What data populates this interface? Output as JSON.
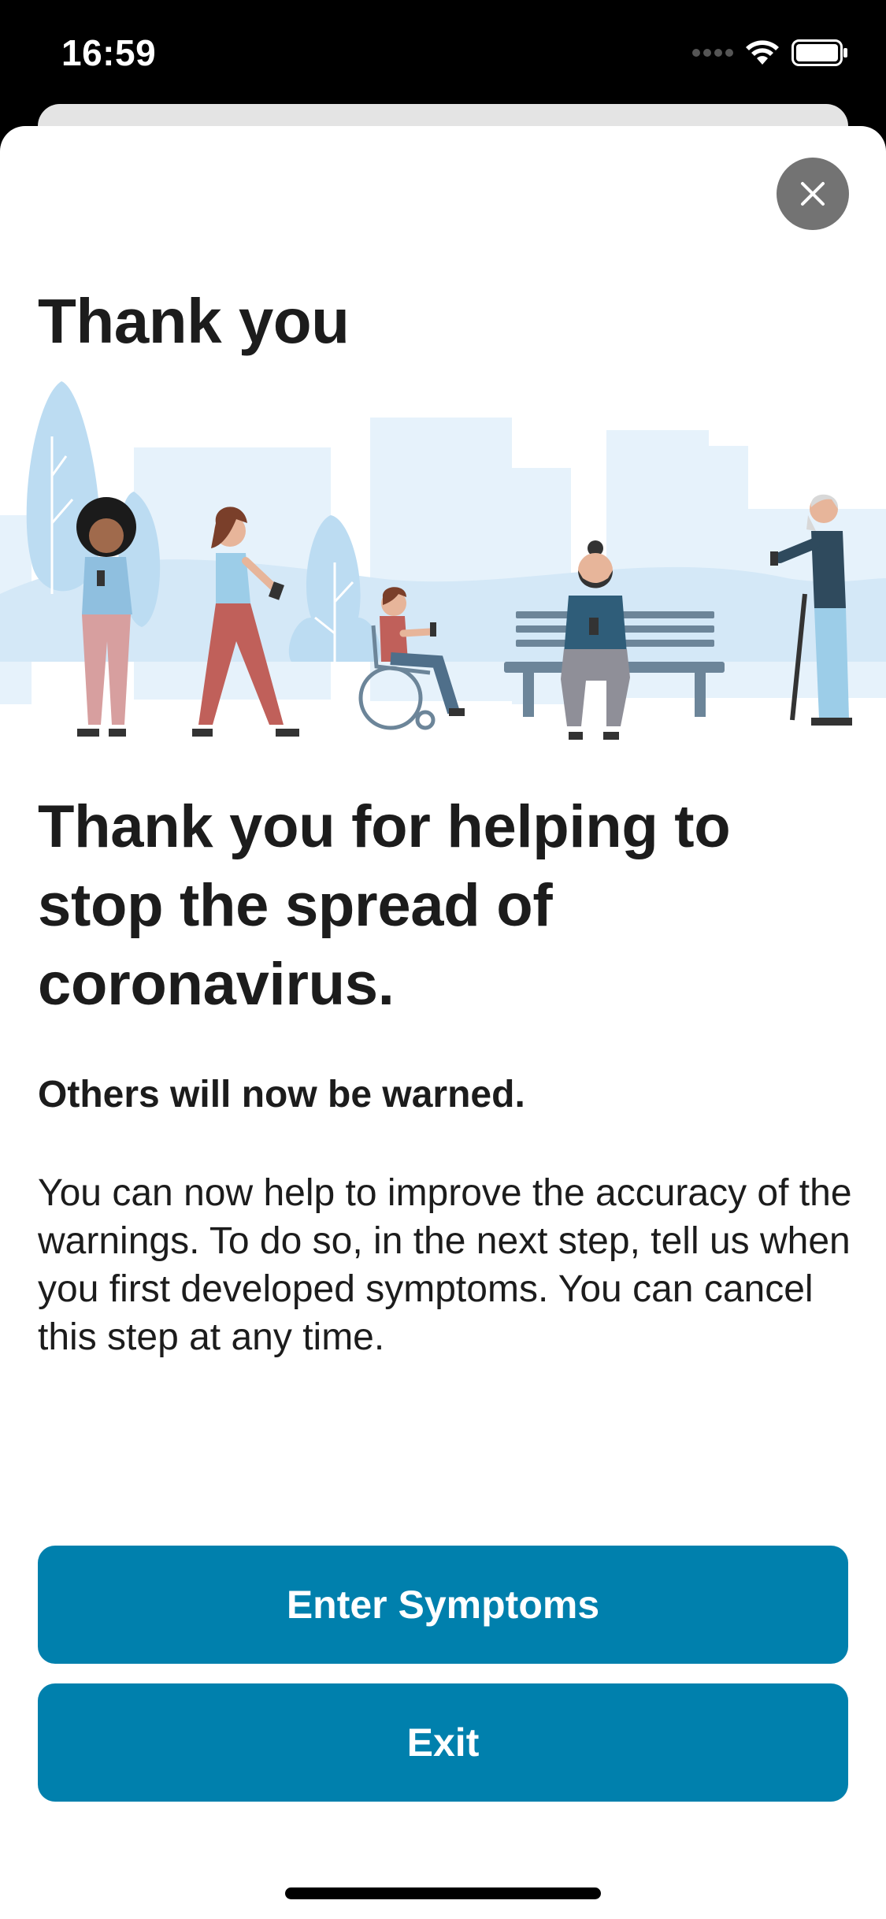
{
  "status_bar": {
    "time": "16:59"
  },
  "page": {
    "title": "Thank you",
    "headline": "Thank you for helping to stop the spread of coronavirus.",
    "subheadline": "Others will now be warned.",
    "body": "You can now help to improve the accuracy of the warnings. To do so, in the next step, tell us when you first developed symptoms. You can cancel this step at any time."
  },
  "buttons": {
    "enter_symptoms": "Enter Symptoms",
    "exit": "Exit"
  },
  "colors": {
    "accent": "#0080ad",
    "close_button": "#737373",
    "illustration_bg": "#e6f2fb"
  },
  "icons": {
    "close": "close-icon",
    "signal": "signal-icon",
    "wifi": "wifi-icon",
    "battery": "battery-icon"
  }
}
